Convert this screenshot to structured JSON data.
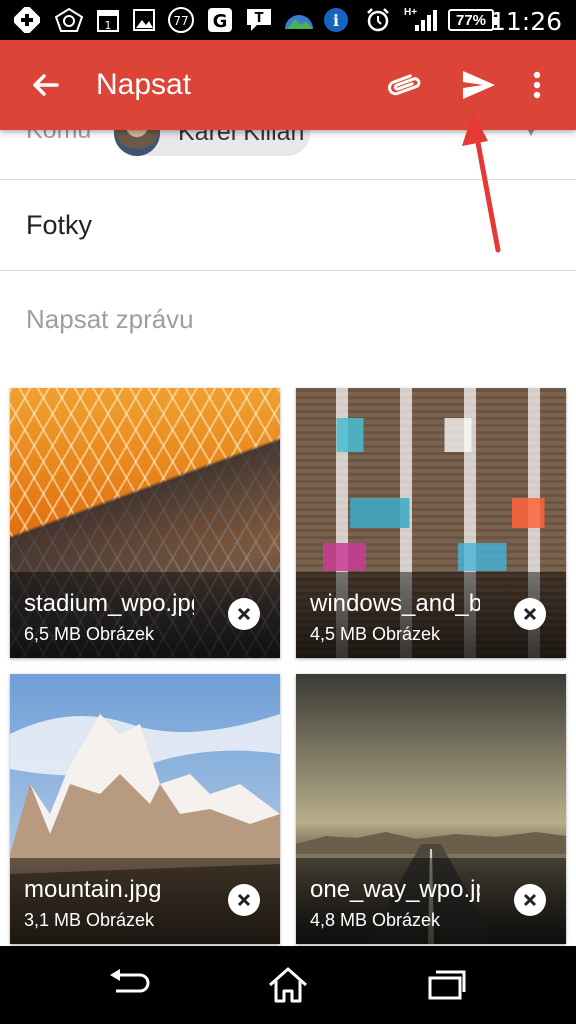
{
  "status_bar": {
    "notification_77": "77",
    "battery": "77%",
    "network": "H+",
    "time": "11:26"
  },
  "app_bar": {
    "title": "Napsat",
    "actions": [
      "back-arrow-icon",
      "paperclip-icon",
      "send-icon",
      "more-vert-icon"
    ],
    "color": "#db4437"
  },
  "compose": {
    "to_label": "Komu",
    "recipient": "Karel Kilián",
    "subject": "Fotky",
    "body_placeholder": "Napsat zprávu"
  },
  "attachments": [
    {
      "name": "stadium_wpo.jpg",
      "meta": "6,5 MB Obrázek"
    },
    {
      "name": "windows_and_balconies.jpg",
      "meta": "4,5 MB Obrázek"
    },
    {
      "name": "mountain.jpg",
      "meta": "3,1 MB Obrázek"
    },
    {
      "name": "one_way_wpo.jpg",
      "meta": "4,8 MB Obrázek"
    }
  ],
  "annotation": {
    "arrow_color": "#e53935"
  },
  "nav_bar": {
    "buttons": [
      "back-icon",
      "home-icon",
      "recent-apps-icon"
    ]
  }
}
